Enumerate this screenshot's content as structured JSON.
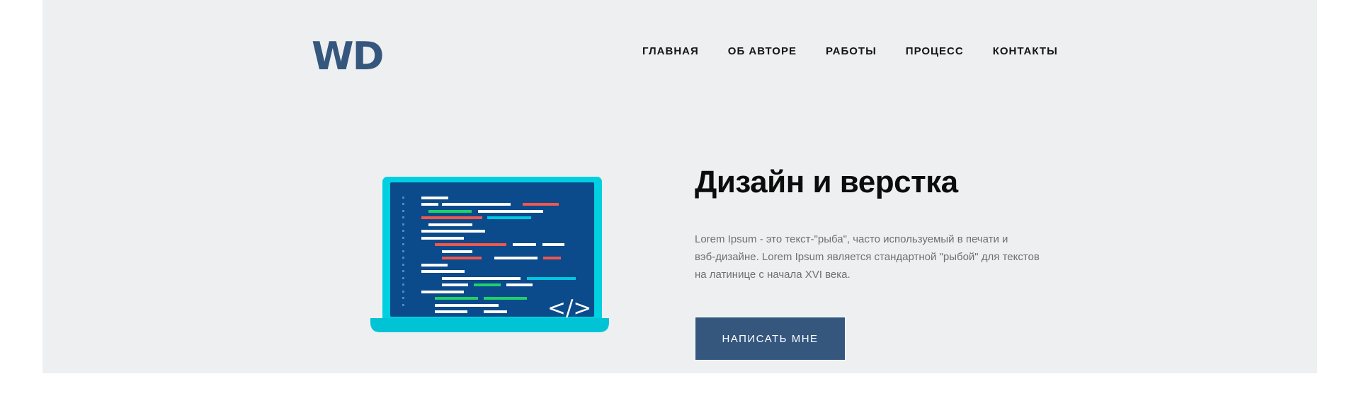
{
  "header": {
    "logo_text": "WD",
    "nav": [
      {
        "label": "ГЛАВНАЯ"
      },
      {
        "label": "ОБ АВТОРЕ"
      },
      {
        "label": "РАБОТЫ"
      },
      {
        "label": "ПРОЦЕСС"
      },
      {
        "label": "КОНТАКТЫ"
      }
    ]
  },
  "hero": {
    "title": "Дизайн и верстка",
    "text_lines": [
      "Lorem Ipsum - это текст-\"рыба\", часто используемый в печати и",
      "вэб-дизайне. Lorem Ipsum является стандартной \"рыбой\" для текстов",
      "на латинице с начала XVI века."
    ],
    "cta_label": "НАПИСАТЬ МНЕ",
    "code_tag": "</>"
  },
  "colors": {
    "hero_background": "#eeeff1",
    "brand": "#35577e",
    "laptop_frame": "#00d0e0",
    "laptop_screen": "#0b4a8b"
  }
}
